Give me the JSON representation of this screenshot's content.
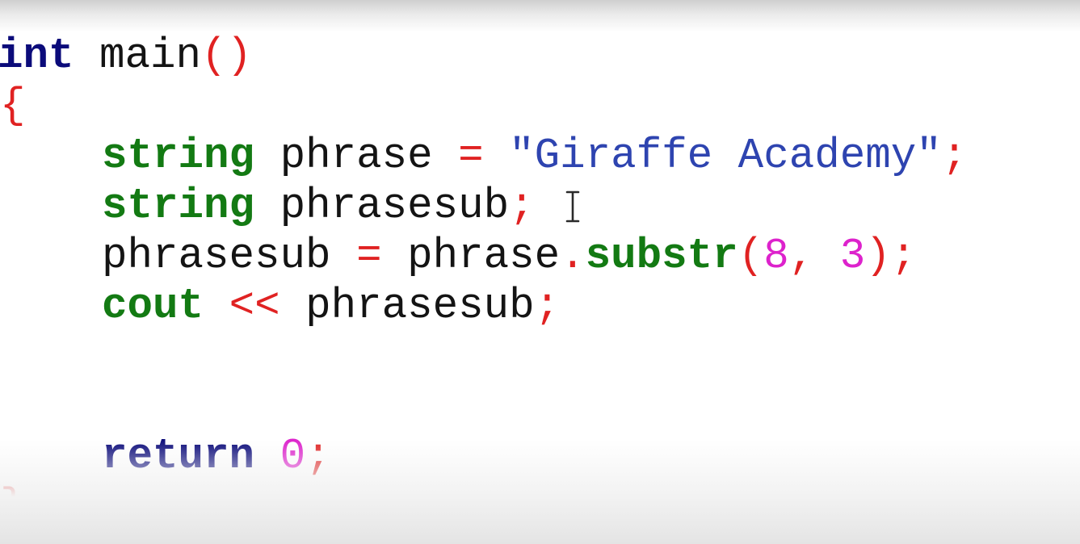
{
  "editor": {
    "lines": [
      {
        "tokens": [
          {
            "text": "int",
            "kind": "kw"
          },
          {
            "text": " main",
            "kind": "ident"
          },
          {
            "text": "()",
            "kind": "punc"
          }
        ]
      },
      {
        "tokens": [
          {
            "text": "{",
            "kind": "punc"
          }
        ]
      },
      {
        "tokens": [
          {
            "text": "    ",
            "kind": "ident"
          },
          {
            "text": "string",
            "kind": "type"
          },
          {
            "text": " phrase ",
            "kind": "ident"
          },
          {
            "text": "=",
            "kind": "op"
          },
          {
            "text": " ",
            "kind": "ident"
          },
          {
            "text": "\"Giraffe Academy\"",
            "kind": "str"
          },
          {
            "text": ";",
            "kind": "punc"
          }
        ]
      },
      {
        "tokens": [
          {
            "text": "    ",
            "kind": "ident"
          },
          {
            "text": "string",
            "kind": "type"
          },
          {
            "text": " phrasesub",
            "kind": "ident"
          },
          {
            "text": ";",
            "kind": "punc"
          }
        ]
      },
      {
        "tokens": [
          {
            "text": "    phrasesub ",
            "kind": "ident"
          },
          {
            "text": "=",
            "kind": "op"
          },
          {
            "text": " phrase",
            "kind": "ident"
          },
          {
            "text": ".",
            "kind": "punc"
          },
          {
            "text": "substr",
            "kind": "fn"
          },
          {
            "text": "(",
            "kind": "punc"
          },
          {
            "text": "8",
            "kind": "num"
          },
          {
            "text": ", ",
            "kind": "punc"
          },
          {
            "text": "3",
            "kind": "num"
          },
          {
            "text": ");",
            "kind": "punc"
          }
        ]
      },
      {
        "tokens": [
          {
            "text": "    ",
            "kind": "ident"
          },
          {
            "text": "cout",
            "kind": "type"
          },
          {
            "text": " ",
            "kind": "ident"
          },
          {
            "text": "<<",
            "kind": "op"
          },
          {
            "text": " phrasesub",
            "kind": "ident"
          },
          {
            "text": ";",
            "kind": "punc"
          }
        ]
      },
      {
        "tokens": []
      },
      {
        "tokens": []
      },
      {
        "tokens": [
          {
            "text": "    ",
            "kind": "ident"
          },
          {
            "text": "return",
            "kind": "kw"
          },
          {
            "text": " ",
            "kind": "ident"
          },
          {
            "text": "0",
            "kind": "num"
          },
          {
            "text": ";",
            "kind": "punc"
          }
        ]
      },
      {
        "tokens": [
          {
            "text": "}",
            "kind": "punc"
          }
        ]
      }
    ]
  },
  "cursor": {
    "icon": "text-cursor-icon",
    "type": "i-beam"
  },
  "colors": {
    "keyword": "#0b0b7a",
    "type": "#137a13",
    "operator": "#e02222",
    "string": "#2e44b0",
    "number": "#dd22cc",
    "identifier": "#141414"
  }
}
